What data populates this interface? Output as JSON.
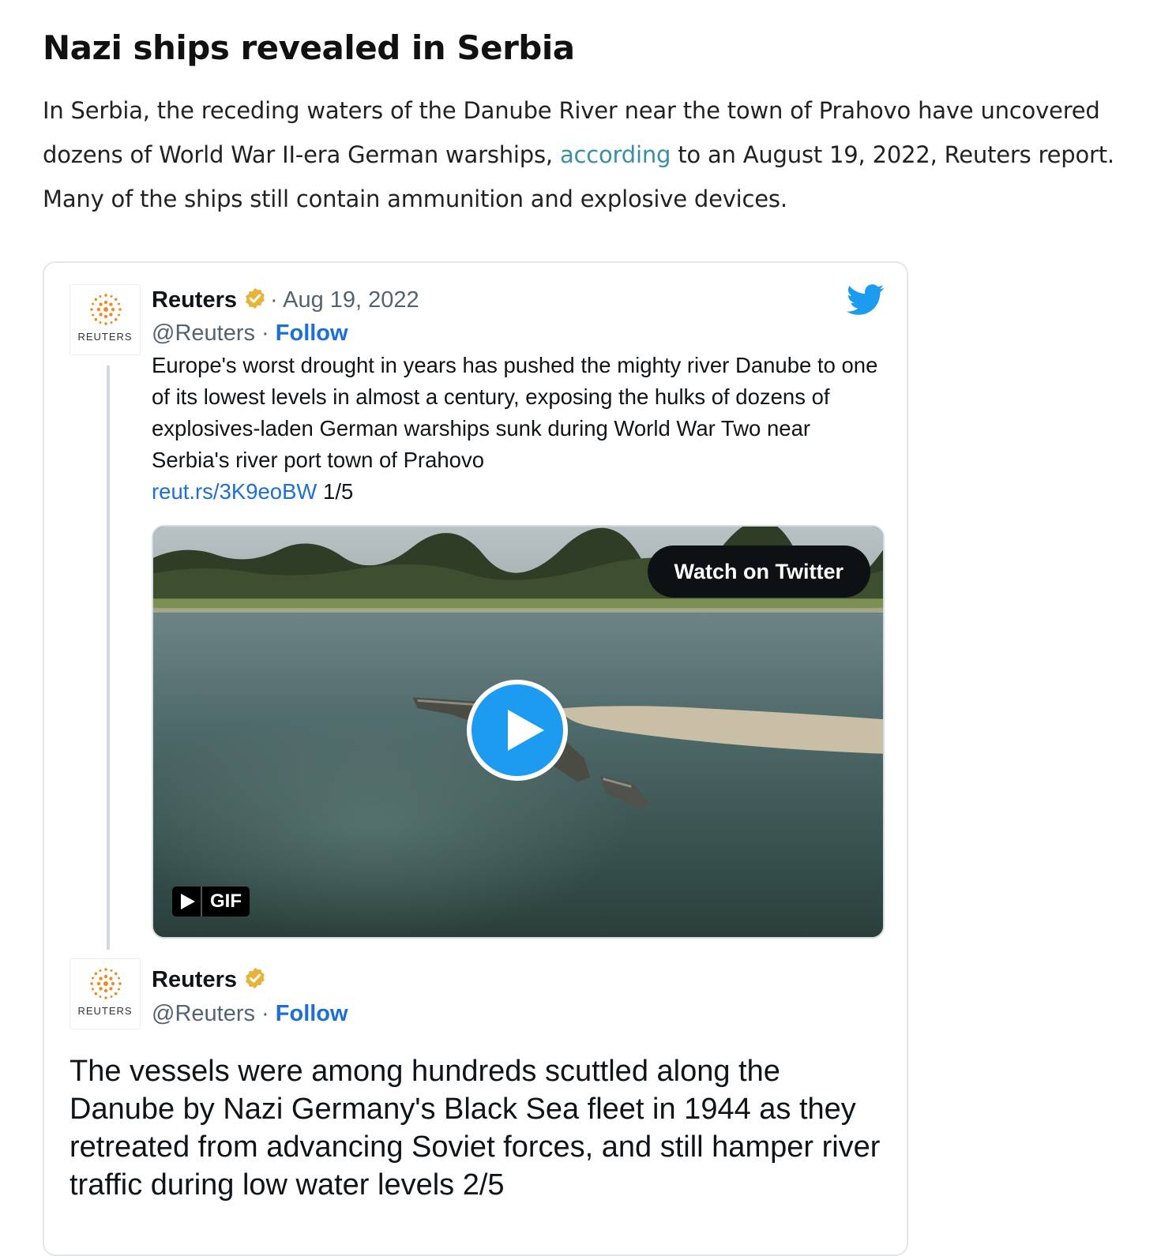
{
  "article": {
    "headline": "Nazi ships revealed in Serbia",
    "lede_part1": "In Serbia, the receding waters of the Danube River near the town of Prahovo have uncovered dozens of World War II-era German warships, ",
    "lede_link": "according",
    "lede_part2": " to an August 19, 2022, Reuters report. Many of the ships still contain ammunition and explosive devices."
  },
  "tweet1": {
    "author": "Reuters",
    "date": "· Aug 19, 2022",
    "handle": "@Reuters",
    "separator": " · ",
    "follow_label": "Follow",
    "avatar_wordmark": "REUTERS",
    "text": "Europe's worst drought in years has pushed the mighty river Danube to one of its lowest levels in almost a century, exposing the hulks of dozens of explosives-laden German warships sunk during World War Two near Serbia's river port town of Prahovo",
    "link": "reut.rs/3K9eoBW",
    "counter": " 1/5",
    "media": {
      "watch_label": "Watch on Twitter",
      "gif_label": "GIF"
    }
  },
  "tweet2": {
    "author": "Reuters",
    "handle": "@Reuters",
    "separator": " · ",
    "follow_label": "Follow",
    "avatar_wordmark": "REUTERS",
    "text": "The vessels were among hundreds scuttled along the Danube by Nazi Germany's Black Sea fleet in 1944 as they retreated from advancing Soviet forces, and still hamper river traffic during low water levels 2/5"
  },
  "colors": {
    "link": "#3a8fa6",
    "twitter_blue": "#1d9bf0",
    "follow_blue": "#1d6fd8",
    "verified_gold": "#e8b339",
    "reuters_orange": "#f08a24"
  },
  "icons": [
    "verified-badge-icon",
    "twitter-bird-icon",
    "reuters-logo-icon",
    "play-icon",
    "gif-play-icon"
  ]
}
